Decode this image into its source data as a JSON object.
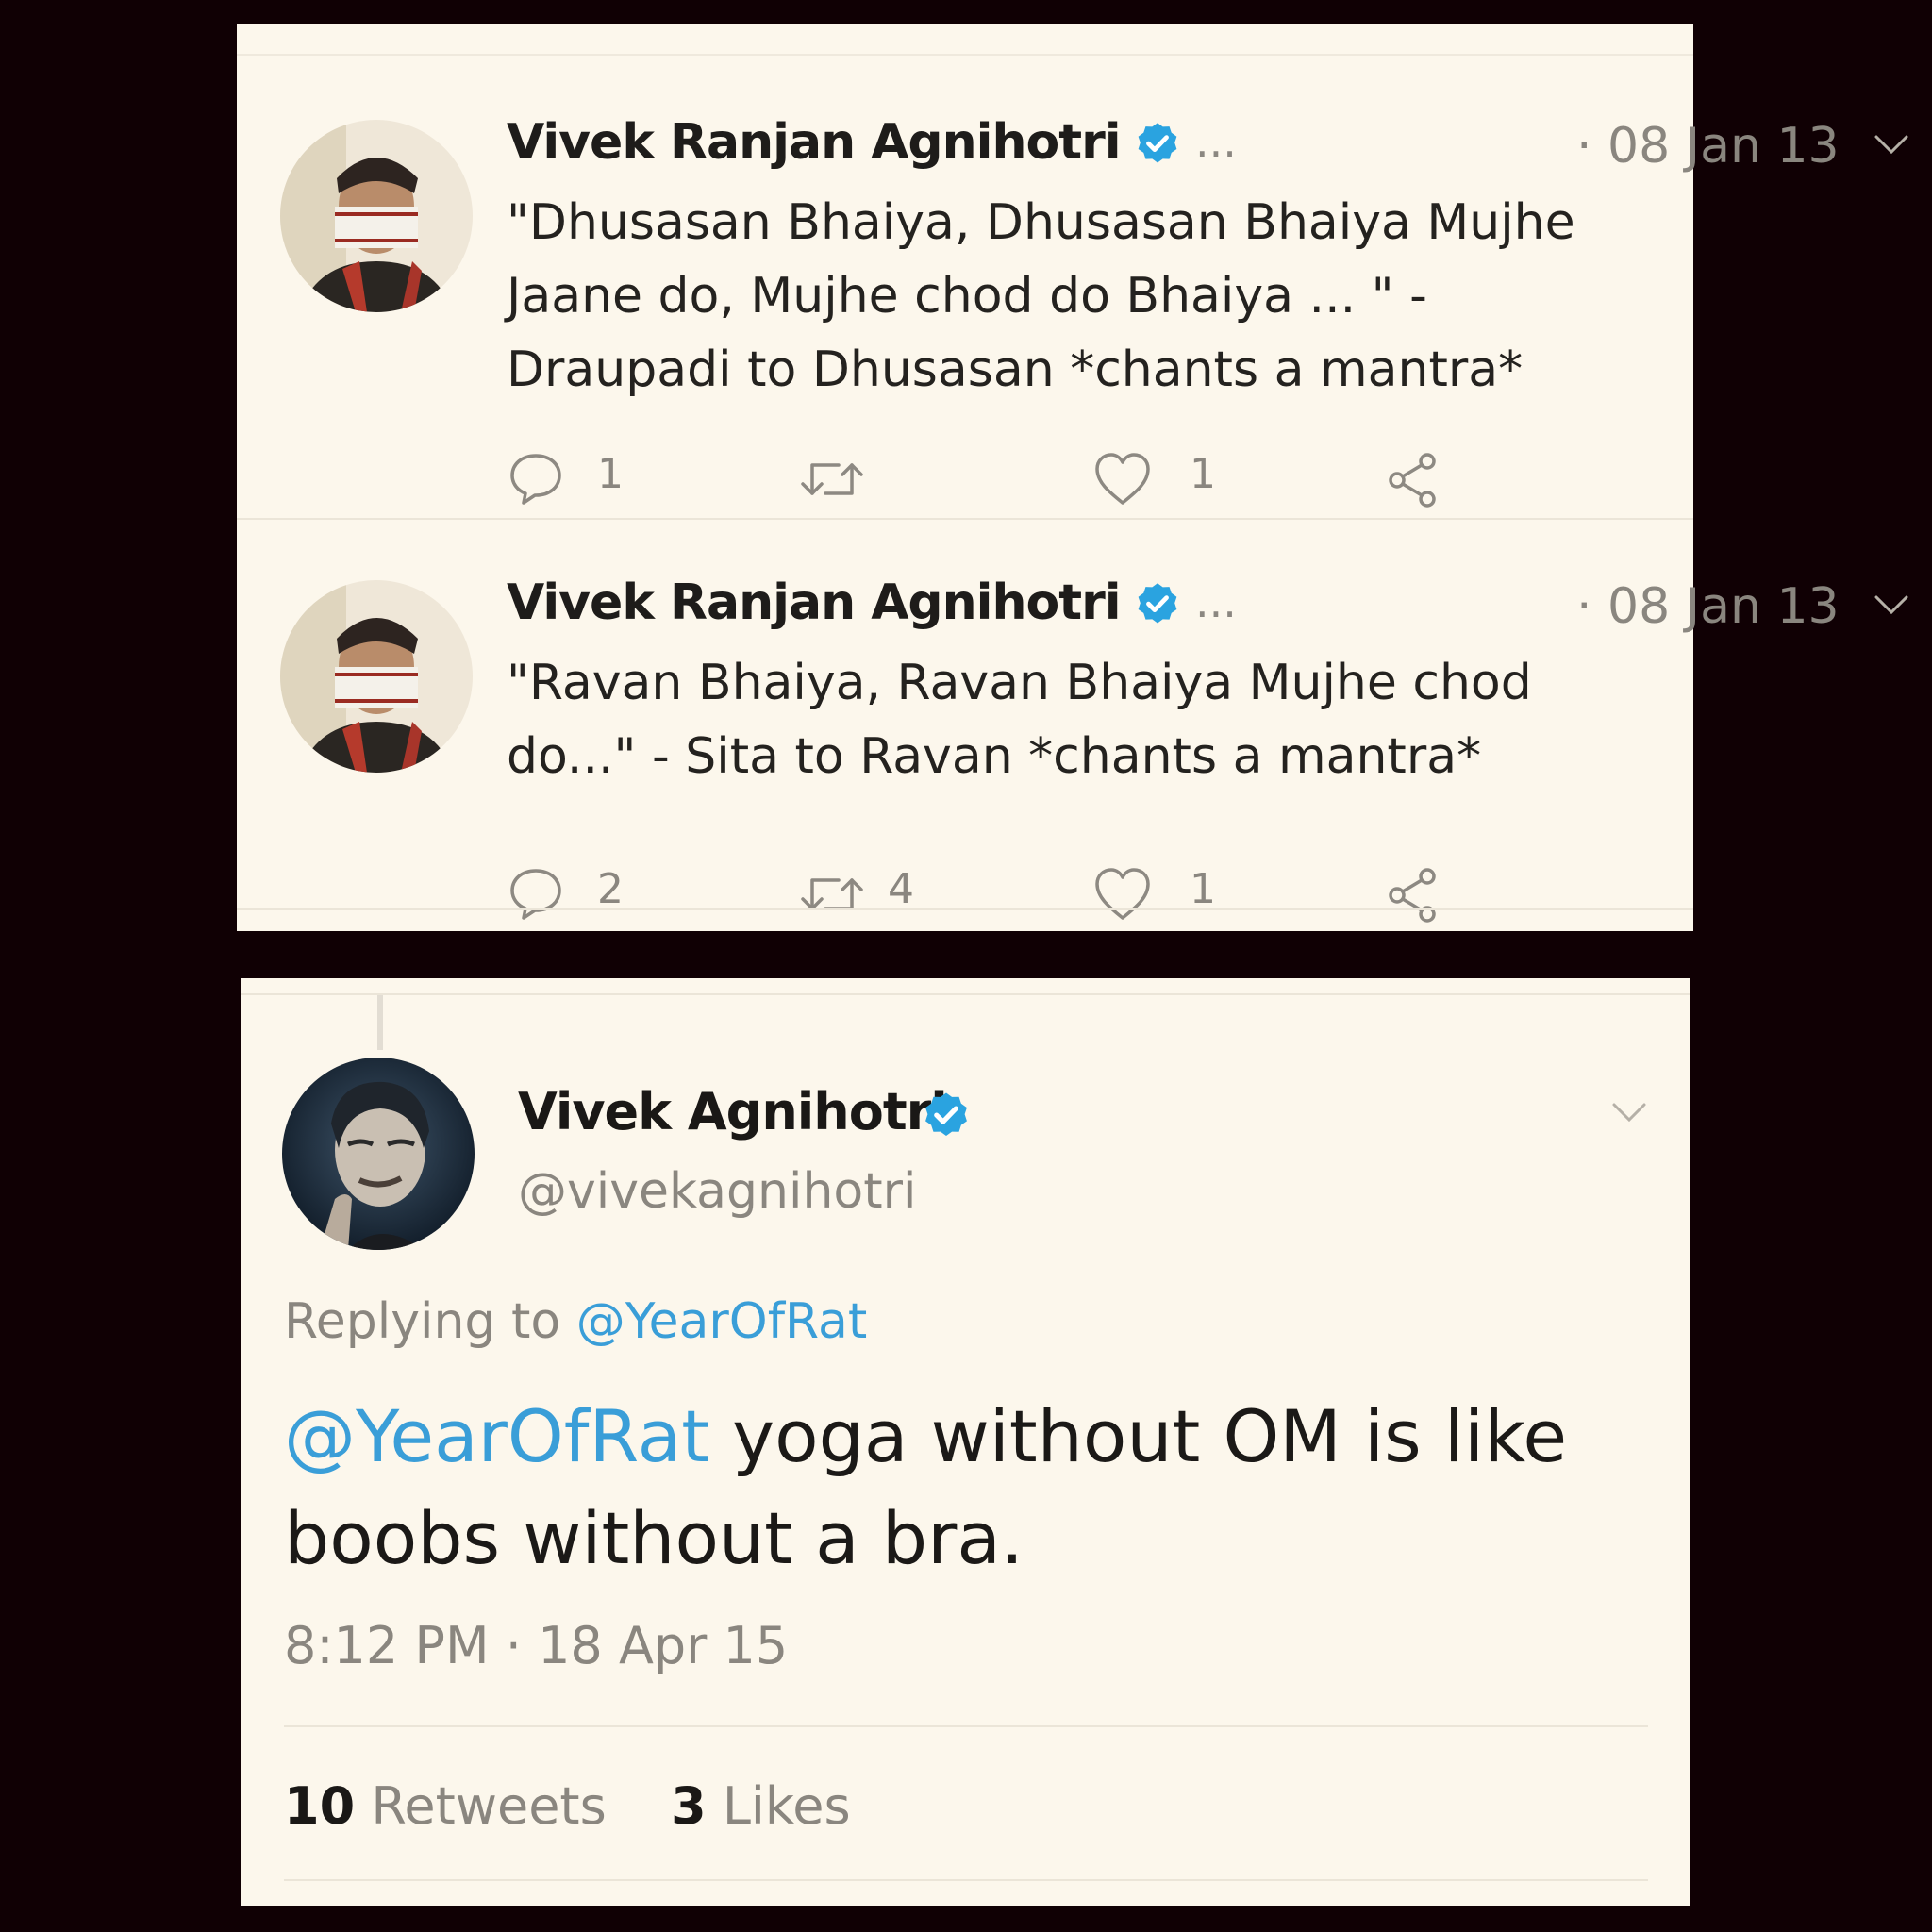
{
  "colors": {
    "background": "#100004",
    "card": "#fcf7ec",
    "verified": "#2aa3e0",
    "mention": "#3a9ed8",
    "muted": "#8a867f"
  },
  "top_thread": {
    "tweets": [
      {
        "author_name": "Vivek Ranjan Agnihotri",
        "ellipsis": "...",
        "date": "· 08 Jan 13",
        "text": "\"Dhusasan Bhaiya, Dhusasan Bhaiya Mujhe Jaane do, Mujhe chod do Bhaiya ... \" - Draupadi to Dhusasan *chants a mantra*",
        "reply_count": "1",
        "retweet_count": "",
        "like_count": "1",
        "icons": [
          "reply-icon",
          "retweet-icon",
          "like-icon",
          "share-icon"
        ]
      },
      {
        "author_name": "Vivek Ranjan Agnihotri",
        "ellipsis": "...",
        "date": "· 08 Jan 13",
        "text": "\"Ravan Bhaiya, Ravan Bhaiya Mujhe chod do...\" - Sita to Ravan *chants a mantra*",
        "reply_count": "2",
        "retweet_count": "4",
        "like_count": "1",
        "icons": [
          "reply-icon",
          "retweet-icon",
          "like-icon",
          "share-icon"
        ]
      }
    ]
  },
  "bottom_tweet": {
    "author_name": "Vivek Agnihotri",
    "handle": "@vivekagnihotri",
    "replying_prefix": "Replying to",
    "replying_handle": "@YearOfRat",
    "text_mention": "@YearOfRat",
    "text_body": " yoga without OM is like boobs without a bra.",
    "timestamp": "8:12 PM · 18 Apr 15",
    "retweets_count": "10",
    "retweets_label": "Retweets",
    "likes_count": "3",
    "likes_label": "Likes"
  }
}
